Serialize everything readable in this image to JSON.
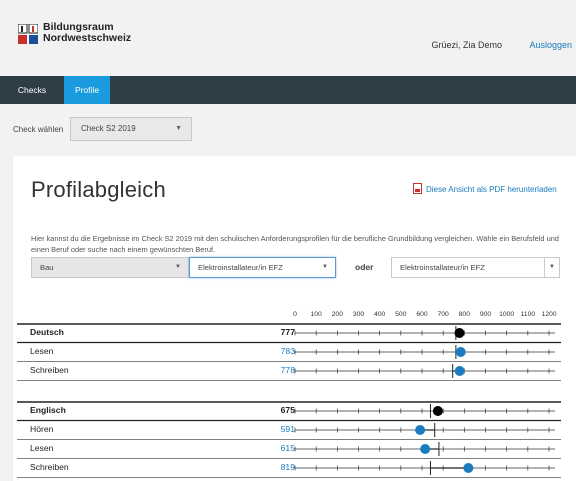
{
  "header": {
    "logo_line1": "Bildungsraum",
    "logo_line2": "Nordwestschweiz",
    "greeting": "Grüezi, Zia Demo",
    "logout_label": "Ausloggen"
  },
  "nav": {
    "tabs": [
      {
        "label": "Checks",
        "active": false
      },
      {
        "label": "Profile",
        "active": true
      }
    ]
  },
  "check_select": {
    "label": "Check wählen",
    "value": "Check S2 2019"
  },
  "profile": {
    "title": "Profilabgleich",
    "pdf_link": "Diese Ansicht als PDF herunterladen",
    "intro": "Hier kannst du die Ergebnisse im Check S2 2019 mit den schulischen Anforderungsprofilen für die berufliche Grundbildung vergleichen. Wähle ein Berufsfeld und einen Beruf oder suche nach einem gewünschten Beruf.",
    "field_select": "Bau",
    "job_select": "Elektroinstallateur/in EFZ",
    "or_label": "oder",
    "search_select": "Elektroinstallateur/in EFZ"
  },
  "colors": {
    "nav_bg": "#2f3d47",
    "nav_active": "#1a9be0",
    "link": "#1a7bbf",
    "marker_blue": "#1a7bbf",
    "marker_black": "#000000"
  },
  "chart_data": {
    "type": "table",
    "scale": {
      "min": 0,
      "max": 1200,
      "ticks": [
        "0",
        "100",
        "200",
        "300",
        "400",
        "500",
        "600",
        "700",
        "800",
        "900",
        "1000",
        "1100",
        "1200"
      ]
    },
    "groups": [
      {
        "rows": [
          {
            "label": "Deutsch",
            "value": 777,
            "display": "777",
            "bold": true,
            "requirement": 760
          },
          {
            "label": "Lesen",
            "value": 783,
            "display": "783",
            "bold": false,
            "requirement": 760
          },
          {
            "label": "Schreiben",
            "value": 778,
            "display": "778",
            "bold": false,
            "requirement": 745
          }
        ]
      },
      {
        "rows": [
          {
            "label": "Englisch",
            "value": 675,
            "display": "675",
            "bold": true,
            "requirement": 640
          },
          {
            "label": "Hören",
            "value": 591,
            "display": "591",
            "bold": false,
            "requirement": 660
          },
          {
            "label": "Lesen",
            "value": 615,
            "display": "615",
            "bold": false,
            "requirement": 680
          },
          {
            "label": "Schreiben",
            "value": 819,
            "display": "819",
            "bold": false,
            "requirement": 640
          }
        ]
      }
    ]
  }
}
